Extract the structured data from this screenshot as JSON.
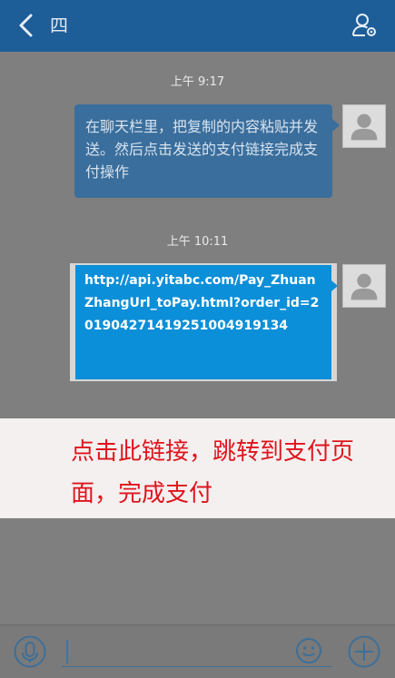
{
  "header": {
    "title": "四",
    "back_icon": "back-arrow-icon",
    "profile_icon": "user-settings-icon"
  },
  "messages": [
    {
      "time": "上午 9:17",
      "text": "在聊天栏里，把复制的内容粘贴并发送。然后点击发送的支付链接完成支付操作"
    },
    {
      "time": "上午 10:11",
      "text": "http://api.yitabc.com/Pay_ZhuanZhangUrl_toPay.html?order_id=2019042714192510049191​34"
    }
  ],
  "overlay": {
    "text": "点击此链接，跳转到支付页面，完成支付",
    "color": "#e0141c"
  },
  "input_bar": {
    "value": "",
    "voice_icon": "microphone-icon",
    "emoji_icon": "emoji-icon",
    "more_icon": "plus-icon"
  },
  "colors": {
    "header": "#1d5d98",
    "bubble": "#3a6e9c",
    "link_bubble": "#0b8fd8",
    "overlay_bg": "#f4f0f0"
  }
}
